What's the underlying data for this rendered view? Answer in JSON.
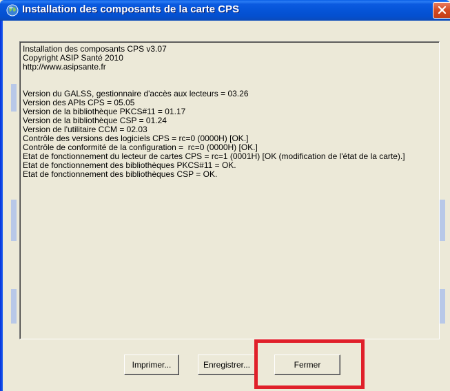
{
  "window": {
    "title": "Installation des composants de la carte CPS"
  },
  "log": {
    "lines": [
      "Installation des composants CPS v3.07",
      "Copyright ASIP Santé 2010",
      "http://www.asipsante.fr",
      "",
      "Version du GALSS, gestionnaire d'accès aux lecteurs = 03.26",
      "Version des APIs CPS = 05.05",
      "Version de la bibliothèque PKCS#11 = 01.17",
      "Version de la bibliothèque CSP = 01.24",
      "Version de l'utilitaire CCM = 02.03",
      "Contrôle des versions des logiciels CPS = rc=0 (0000H) [OK.]",
      "Contrôle de conformité de la configuration =  rc=0 (0000H) [OK.]",
      "Etat de fonctionnement du lecteur de cartes CPS =  rc=1 (0001H) [OK (modification de l'état de la carte).]",
      "Etat de fonctionnement des bibliothèques PKCS#11 = OK.",
      "Etat de fonctionnement des bibliothèques CSP = OK."
    ]
  },
  "buttons": {
    "print": "Imprimer...",
    "save": "Enregistrer...",
    "close": "Fermer"
  },
  "colors": {
    "titlebar": "#0554d8",
    "close_button": "#d34a22",
    "highlight": "#e0202a",
    "dialog_background": "#ece9d8"
  }
}
